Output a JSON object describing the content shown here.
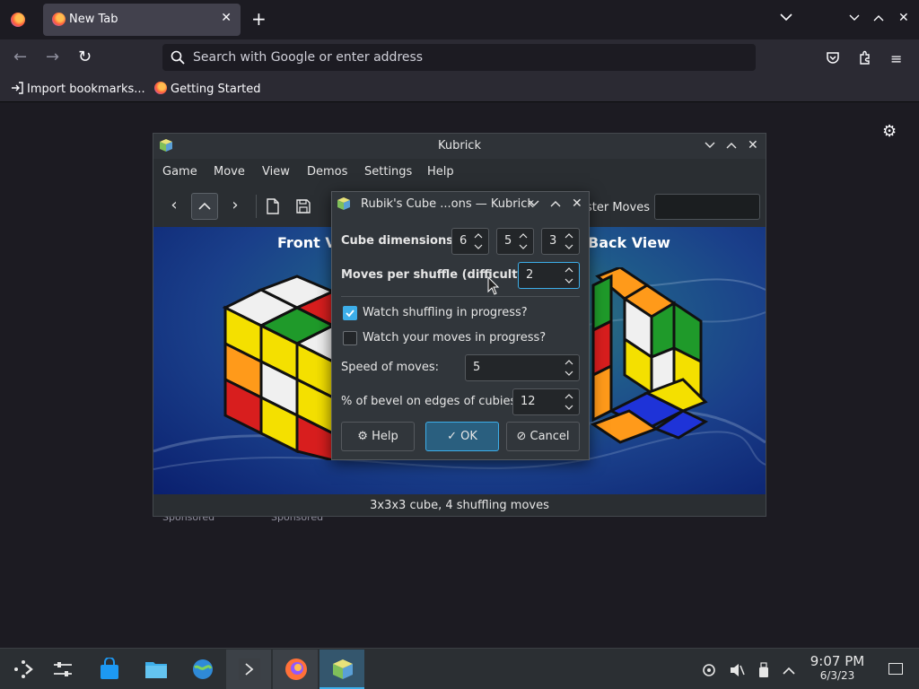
{
  "browser": {
    "tab_title": "New Tab",
    "search_placeholder": "Search with Google or enter address",
    "bookmarks": [
      "Import bookmarks...",
      "Getting Started"
    ],
    "sponsored_labels": [
      "Sponsored",
      "Sponsored"
    ]
  },
  "kubrick": {
    "title": "Kubrick",
    "menu": [
      "Game",
      "Move",
      "View",
      "Demos",
      "Settings",
      "Help"
    ],
    "moves_label": "ster Moves",
    "scene_titles": {
      "front": "Front V",
      "back": "Back View"
    },
    "status": "3x3x3 cube, 4 shuffling moves"
  },
  "dialog": {
    "title": "Rubik's Cube ...ons — Kubrick",
    "cube_dimensions_label": "Cube dimensions:",
    "dimensions": [
      "6",
      "5",
      "3"
    ],
    "moves_per_shuffle_label": "Moves per shuffle (difficulty):",
    "moves_per_shuffle_value": "2",
    "watch_shuffling_label": "Watch shuffling in progress?",
    "watch_shuffling_checked": true,
    "watch_moves_label": "Watch your moves in progress?",
    "watch_moves_checked": false,
    "speed_label": "Speed of moves:",
    "speed_value": "5",
    "bevel_label": "% of bevel on edges of cubies:",
    "bevel_value": "12",
    "buttons": {
      "help": "Help",
      "ok": "OK",
      "cancel": "Cancel"
    }
  },
  "taskbar": {
    "time": "9:07 PM",
    "date": "6/3/23"
  },
  "colors": {
    "accent": "#3daee9",
    "window_bg": "#31363b",
    "browser_bg": "#1c1b22"
  }
}
